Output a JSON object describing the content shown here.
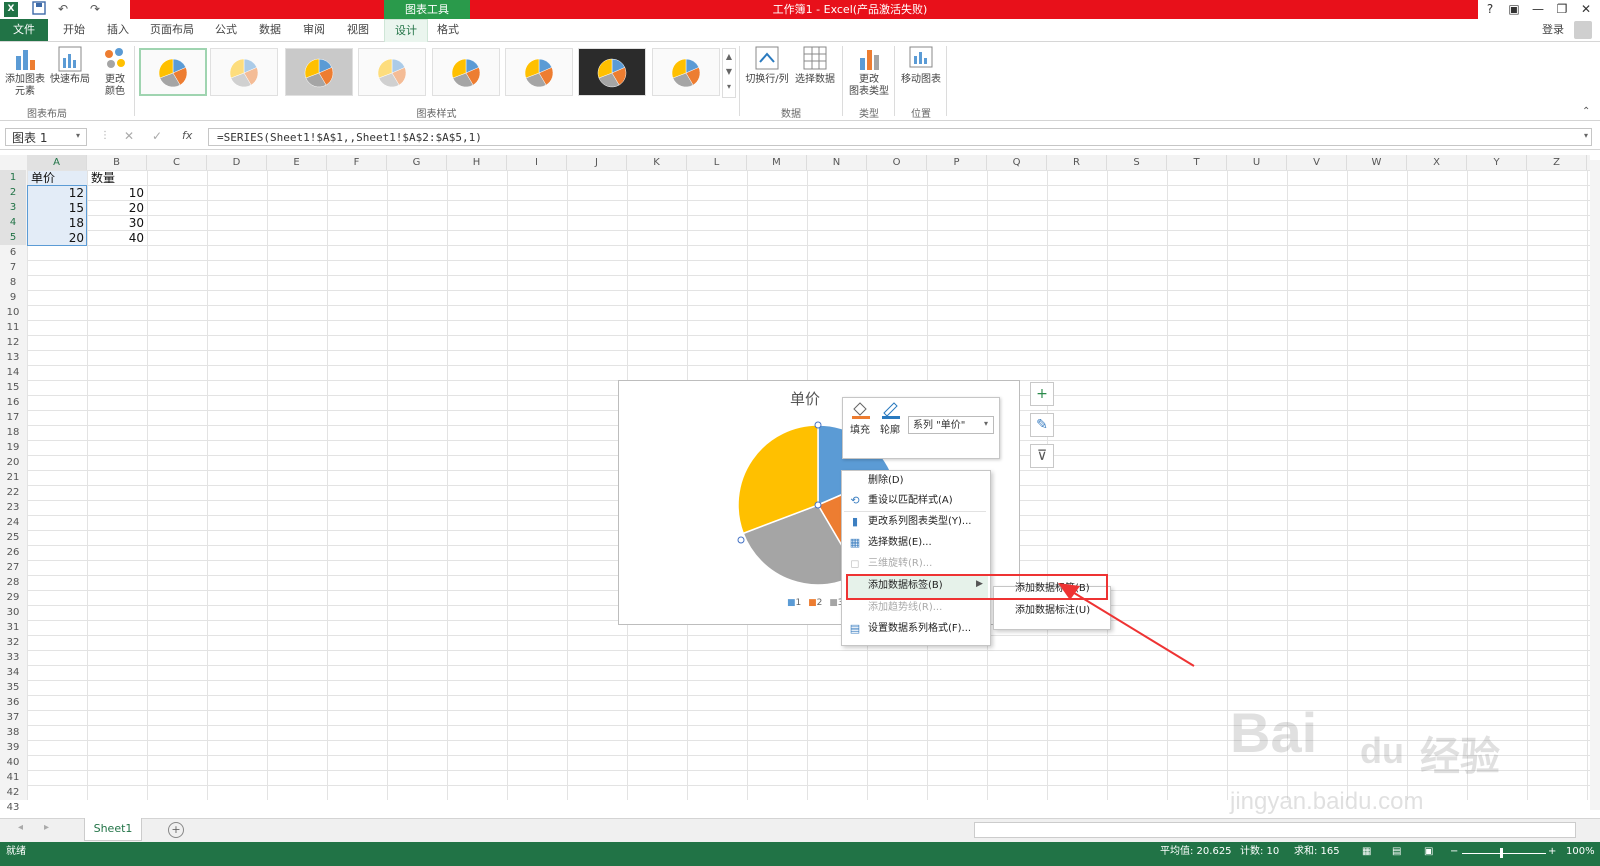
{
  "window": {
    "title": "工作簿1 - Excel(产品激活失败)",
    "context_tab_group": "图表工具",
    "sign_in": "登录",
    "help": "?",
    "minimize": "—",
    "restore": "❐",
    "close": "✕"
  },
  "quick_access": {
    "undo": "↶",
    "redo": "↷"
  },
  "tabs": [
    {
      "label": "文件"
    },
    {
      "label": "开始"
    },
    {
      "label": "插入"
    },
    {
      "label": "页面布局"
    },
    {
      "label": "公式"
    },
    {
      "label": "数据"
    },
    {
      "label": "审阅"
    },
    {
      "label": "视图"
    },
    {
      "label": "设计"
    },
    {
      "label": "格式"
    }
  ],
  "ribbon": {
    "add_element": "添加图表",
    "add_element_2": "元素",
    "quick_layout": "快速布局",
    "change_colors": "更改",
    "change_colors_2": "颜色",
    "group_chart_layout": "图表布局",
    "group_chart_styles": "图表样式",
    "switch_row_col": "切换行/列",
    "select_data": "选择数据",
    "group_data": "数据",
    "change_type": "更改",
    "change_type_2": "图表类型",
    "group_type": "类型",
    "move_chart": "移动图表",
    "group_location": "位置"
  },
  "formula_bar": {
    "name_box": "图表 1",
    "cancel": "✕",
    "enter": "✓",
    "fx": "fx",
    "formula": "=SERIES(Sheet1!$A$1,,Sheet1!$A$2:$A$5,1)"
  },
  "columns": [
    "A",
    "B",
    "C",
    "D",
    "E",
    "F",
    "G",
    "H",
    "I",
    "J",
    "K",
    "L",
    "M",
    "N",
    "O",
    "P",
    "Q",
    "R",
    "S",
    "T",
    "U",
    "V",
    "W",
    "X",
    "Y",
    "Z"
  ],
  "rows": [
    "1",
    "2",
    "3",
    "4",
    "5",
    "6",
    "7",
    "8",
    "9",
    "10",
    "11",
    "12",
    "13",
    "14",
    "15",
    "16",
    "17",
    "18",
    "19",
    "20",
    "21",
    "22",
    "23",
    "24",
    "25",
    "26",
    "27",
    "28",
    "29",
    "30",
    "31",
    "32",
    "33",
    "34",
    "35",
    "36",
    "37",
    "38",
    "39",
    "40",
    "41",
    "42",
    "43"
  ],
  "cells": {
    "A1": "单价",
    "B1": "数量",
    "A2": "12",
    "B2": "10",
    "A3": "15",
    "B3": "20",
    "A4": "18",
    "B4": "30",
    "A5": "20",
    "B5": "40"
  },
  "chart_data": {
    "type": "pie",
    "title": "单价",
    "categories": [
      "1",
      "2",
      "3",
      "4"
    ],
    "values": [
      12,
      15,
      18,
      20
    ],
    "colors": [
      "#5b9bd5",
      "#ed7d31",
      "#a5a5a5",
      "#ffc000"
    ],
    "legend": "bottom",
    "legend_visible": [
      "1",
      "2",
      "3"
    ]
  },
  "chart_tools": {
    "add": "+",
    "style": "✎",
    "filter": "⊽"
  },
  "mini_toolbar": {
    "fill_label": "填充",
    "outline_label": "轮廓",
    "series_select": "系列 \"单价\""
  },
  "context_menu": {
    "delete": "删除(D)",
    "reset_style": "重设以匹配样式(A)",
    "change_series_type": "更改系列图表类型(Y)...",
    "select_data": "选择数据(E)...",
    "rotate_3d": "三维旋转(R)...",
    "add_data_labels": "添加数据标签(B)",
    "add_trendline": "添加趋势线(R)...",
    "format_series": "设置数据系列格式(F)..."
  },
  "submenu": {
    "add_data_labels": "添加数据标签(B)",
    "add_data_callouts": "添加数据标注(U)"
  },
  "sheets": {
    "active": "Sheet1",
    "add": "+"
  },
  "status": {
    "ready": "就绪",
    "average": "平均值: 20.625",
    "count": "计数: 10",
    "sum": "求和: 165",
    "zoom": "100%"
  },
  "watermark": {
    "line1": "Bai",
    "line2": "du",
    "line3": "经验",
    "url": "jingyan.baidu.com"
  },
  "colors": {
    "excel_green": "#217346",
    "title_red": "#e8101a",
    "highlight_red": "#ee3333"
  }
}
